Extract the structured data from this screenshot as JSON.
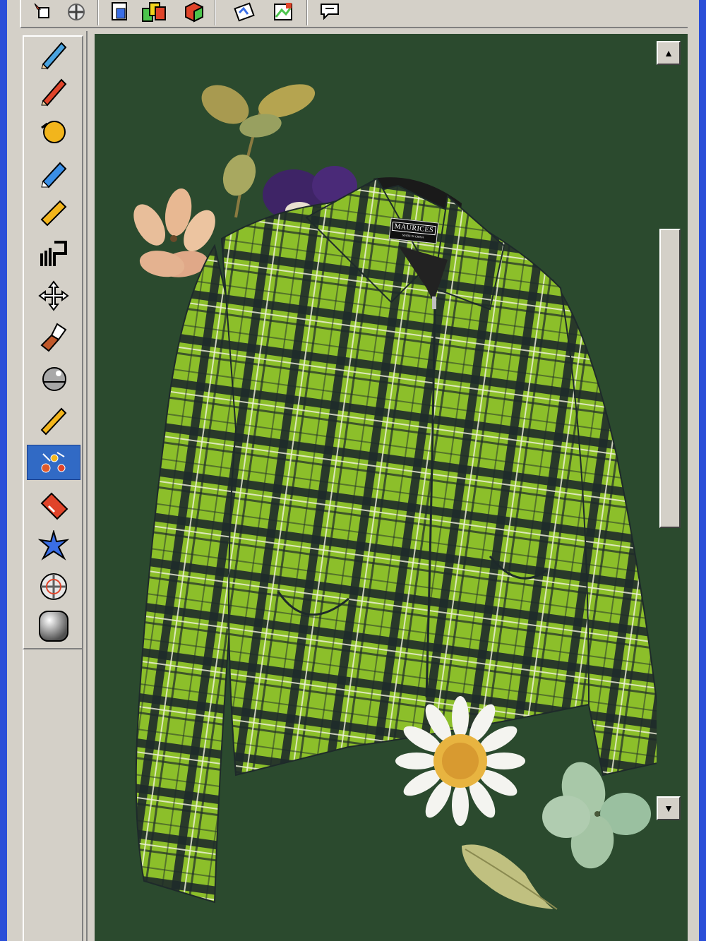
{
  "app": {
    "frame_color": "#2b4fd8",
    "chrome_color": "#d4d0c8",
    "canvas_color": "#2b4a2e"
  },
  "toolbar": {
    "buttons": [
      {
        "name": "select-region-icon"
      },
      {
        "name": "move-crosshair-icon"
      },
      {
        "name": "layer-copy-icon"
      },
      {
        "name": "layers-color-icon"
      },
      {
        "name": "3d-box-icon"
      },
      {
        "name": "image-rotate-icon"
      },
      {
        "name": "image-edit-icon"
      },
      {
        "name": "comment-icon"
      }
    ]
  },
  "tools": [
    {
      "name": "pen-tool-icon",
      "color": "#4aa3e0"
    },
    {
      "name": "pencil-tool-icon",
      "color": "#e0442a"
    },
    {
      "name": "fill-bucket-icon",
      "color": "#f2b51c"
    },
    {
      "name": "marker-tool-icon",
      "color": "#3a8ee6"
    },
    {
      "name": "crayon-tool-icon",
      "color": "#f2b51c"
    },
    {
      "name": "stamp-tool-icon",
      "color": "#404040"
    },
    {
      "name": "move-tool-icon",
      "color": "#404040"
    },
    {
      "name": "brush-tool-icon",
      "color": "#c0582a"
    },
    {
      "name": "smudge-tool-icon",
      "color": "#808080"
    },
    {
      "name": "ruler-tool-icon",
      "color": "#f2b51c"
    },
    {
      "name": "scatter-tool-icon",
      "color": "#e05a2a",
      "selected": true
    },
    {
      "name": "eraser-tool-icon",
      "color": "#e0442a"
    },
    {
      "name": "sparkle-tool-icon",
      "color": "#3a6ee6"
    },
    {
      "name": "target-tool-icon",
      "color": "#c0c0c0"
    },
    {
      "name": "sphere-tool-icon",
      "color": "#808080"
    }
  ],
  "jacket_label": {
    "brand": "MAURICES",
    "sub": "MADE IN CHINA"
  },
  "scrollbar": {
    "up_symbol": "▲",
    "down_symbol": "▼"
  }
}
